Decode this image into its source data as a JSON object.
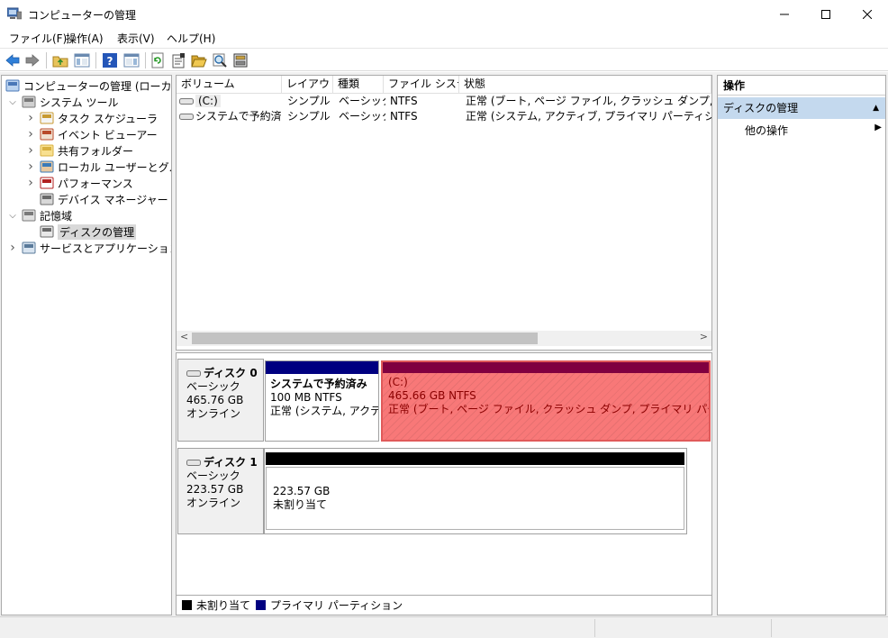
{
  "window": {
    "title": "コンピューターの管理"
  },
  "menu": [
    "ファイル(F)",
    "操作(A)",
    "表示(V)",
    "ヘルプ(H)"
  ],
  "tree": [
    {
      "label": "コンピューターの管理 (ローカル)",
      "level": 0,
      "expander": "",
      "icon": "computer-management-icon"
    },
    {
      "label": "システム ツール",
      "level": 1,
      "expander": "expanded",
      "icon": "system-tools-icon"
    },
    {
      "label": "タスク スケジューラ",
      "level": 2,
      "expander": "collapsed",
      "icon": "task-scheduler-icon"
    },
    {
      "label": "イベント ビューアー",
      "level": 2,
      "expander": "collapsed",
      "icon": "event-viewer-icon"
    },
    {
      "label": "共有フォルダー",
      "level": 2,
      "expander": "collapsed",
      "icon": "shared-folders-icon"
    },
    {
      "label": "ローカル ユーザーとグループ",
      "level": 2,
      "expander": "collapsed",
      "icon": "local-users-icon"
    },
    {
      "label": "パフォーマンス",
      "level": 2,
      "expander": "collapsed",
      "icon": "performance-icon"
    },
    {
      "label": "デバイス マネージャー",
      "level": 2,
      "expander": "",
      "icon": "device-manager-icon"
    },
    {
      "label": "記憶域",
      "level": 1,
      "expander": "expanded",
      "icon": "storage-icon"
    },
    {
      "label": "ディスクの管理",
      "level": 2,
      "expander": "",
      "icon": "disk-management-icon",
      "selected": true
    },
    {
      "label": "サービスとアプリケーション",
      "level": 1,
      "expander": "collapsed",
      "icon": "services-apps-icon"
    }
  ],
  "volume_table": {
    "columns": [
      "ボリューム",
      "レイアウト",
      "種類",
      "ファイル システム",
      "状態"
    ],
    "rows": [
      [
        "(C:)",
        "シンプル",
        "ベーシック",
        "NTFS",
        "正常 (ブート, ページ ファイル, クラッシュ ダンプ, プライマリ パーティション)"
      ],
      [
        "システムで予約済み",
        "シンプル",
        "ベーシック",
        "NTFS",
        "正常 (システム, アクティブ, プライマリ パーティション)"
      ]
    ]
  },
  "disks": [
    {
      "name": "ディスク 0",
      "type": "ベーシック",
      "size": "465.76 GB",
      "status": "オンライン",
      "partitions": [
        {
          "title": "システムで予約済み",
          "size": "100 MB NTFS",
          "status": "正常 (システム, アクティブ, プライマリ パーティション)",
          "color": "#000080",
          "selected": false
        },
        {
          "title": "(C:)",
          "size": "465.66 GB NTFS",
          "status": "正常 (ブート, ページ ファイル, クラッシュ ダンプ, プライマリ パーティション)",
          "color": "#800040",
          "selected": true
        }
      ]
    },
    {
      "name": "ディスク 1",
      "type": "ベーシック",
      "size": "223.57 GB",
      "status": "オンライン",
      "partitions": [
        {
          "title": "",
          "size": "223.57 GB",
          "status": "未割り当て",
          "color": "#000000",
          "selected": false
        }
      ]
    }
  ],
  "legend": [
    {
      "label": "未割り当て",
      "color": "#000000"
    },
    {
      "label": "プライマリ パーティション",
      "color": "#000080"
    }
  ],
  "actions": {
    "header": "操作",
    "section": "ディスクの管理",
    "items": [
      "他の操作"
    ]
  },
  "colors": {
    "selected_partition_fill": "#f87878",
    "selected_partition_text": "#8b0000",
    "action_section_bg": "#c4d9ee"
  }
}
